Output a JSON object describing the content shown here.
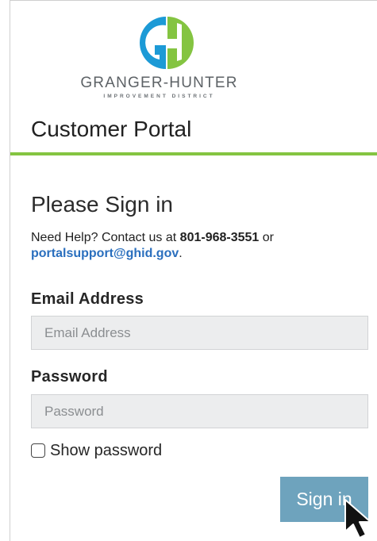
{
  "brand": {
    "name": "GRANGER-HUNTER",
    "subtitle": "IMPROVEMENT DISTRICT",
    "colors": {
      "blue": "#1c9ad6",
      "green": "#84c441",
      "accent_rule": "#84c441"
    }
  },
  "header": {
    "title": "Customer Portal"
  },
  "signin": {
    "heading": "Please Sign in",
    "help_prefix": "Need Help? Contact us at ",
    "help_phone": "801-968-3551",
    "help_middle": " or",
    "help_email": "portalsupport@ghid.gov",
    "help_suffix": "."
  },
  "form": {
    "email_label": "Email Address",
    "email_placeholder": "Email Address",
    "email_value": "",
    "password_label": "Password",
    "password_placeholder": "Password",
    "password_value": "",
    "show_password_label": "Show password",
    "show_password_checked": false,
    "submit_label": "Sign in",
    "submit_color": "#6ea3bd"
  },
  "icons": {
    "logo": "gh-logo-icon",
    "cursor": "mouse-pointer-icon",
    "checkbox": "checkbox-icon"
  }
}
